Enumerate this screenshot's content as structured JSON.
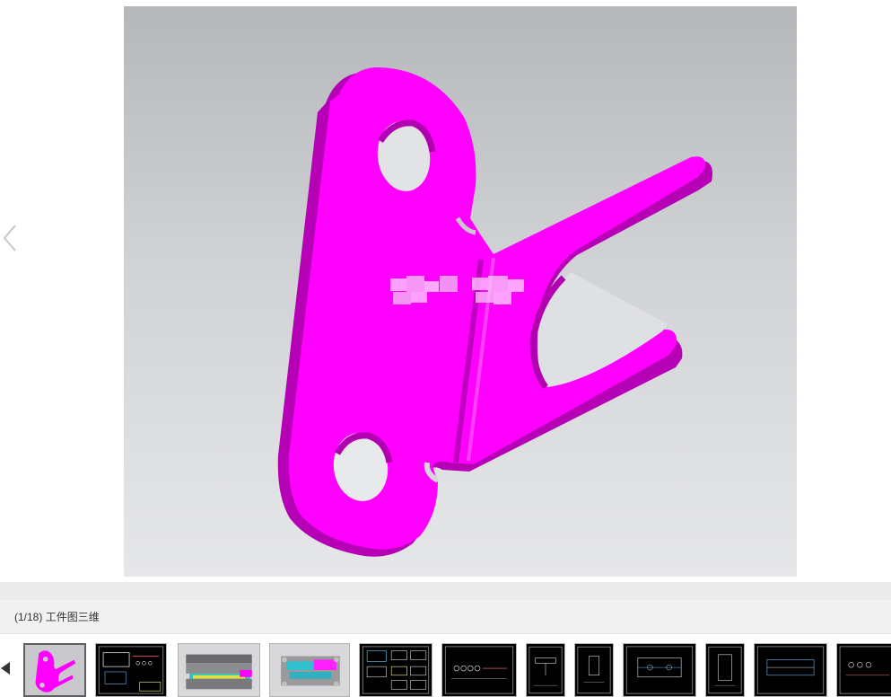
{
  "caption": {
    "counter": "(1/18)",
    "title": "工件图三维"
  },
  "colors": {
    "part": "#ff00ff",
    "part_shade": "#b600b6",
    "thumb_border": "#b5b5b5",
    "active_border": "#5f5f5f"
  },
  "icons": {
    "prev_main": "chevron-left-icon",
    "prev_thumb": "triangle-left-icon"
  },
  "thumbnails": [
    {
      "kind": "part-3d",
      "active": true
    },
    {
      "kind": "cad-drawing",
      "active": false
    },
    {
      "kind": "mold-3d",
      "active": false
    },
    {
      "kind": "mold-3d",
      "active": false
    },
    {
      "kind": "cad-drawing",
      "active": false
    },
    {
      "kind": "cad-drawing",
      "active": false
    },
    {
      "kind": "cad-drawing",
      "active": false
    },
    {
      "kind": "cad-drawing",
      "active": false
    },
    {
      "kind": "cad-drawing",
      "active": false
    },
    {
      "kind": "cad-drawing",
      "active": false
    },
    {
      "kind": "cad-drawing",
      "active": false
    },
    {
      "kind": "cad-drawing",
      "active": false
    }
  ]
}
